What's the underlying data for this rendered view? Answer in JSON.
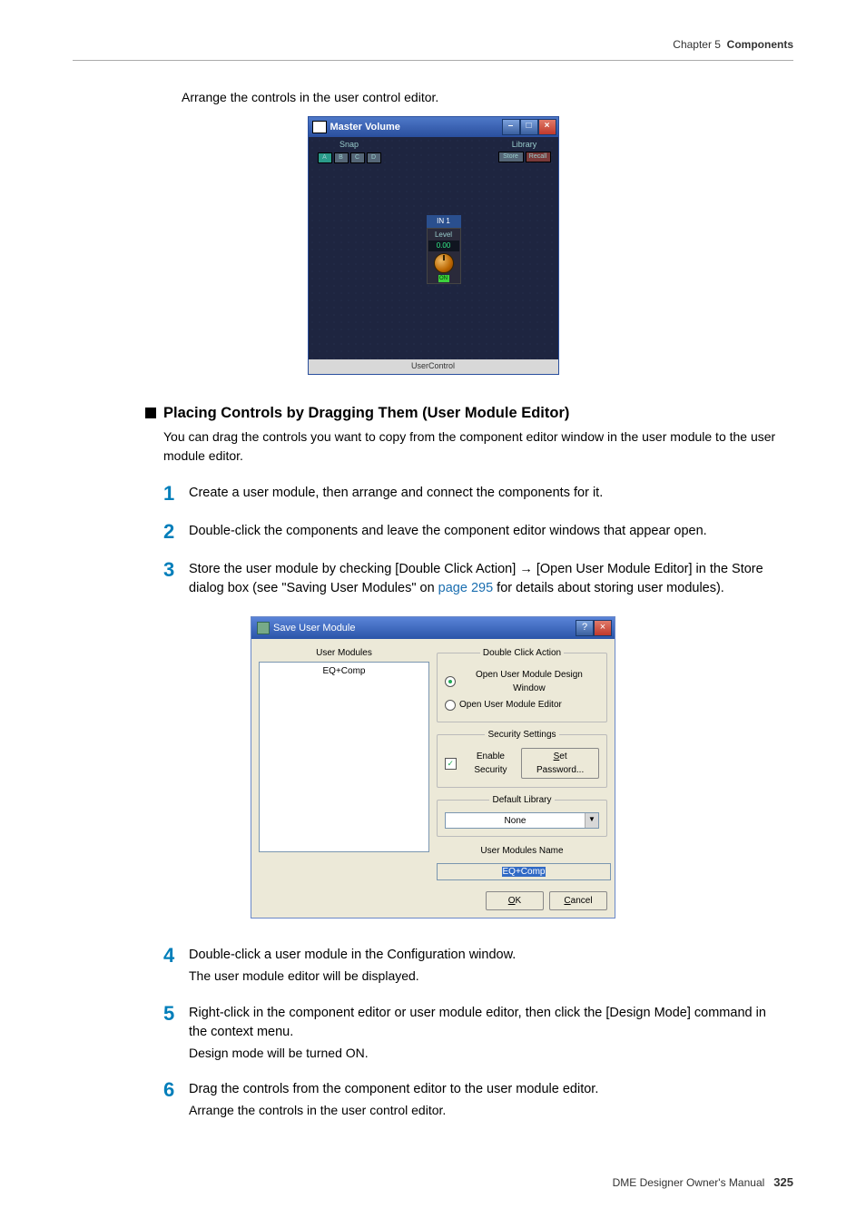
{
  "header": {
    "chapter": "Chapter 5",
    "title": "Components"
  },
  "intro": "Arrange the controls in the user control editor.",
  "mv": {
    "title": "Master Volume",
    "min": "–",
    "max": "□",
    "close": "×",
    "snap_label": "Snap",
    "snap_a": "A",
    "snap_b": "B",
    "snap_c": "C",
    "snap_d": "D",
    "lib_label": "Library",
    "lib_store": "Store",
    "lib_recall": "Recall",
    "comp_title": "IN 1",
    "level": "Level",
    "level_val": "0.00",
    "on": "ON",
    "status": "UserControl"
  },
  "section": {
    "title": "Placing Controls by Dragging Them (User Module Editor)",
    "desc": "You can drag the controls you want to copy from the component editor window in the user module to the user module editor."
  },
  "steps": {
    "s1": "Create a user module, then arrange and connect the components for it.",
    "s2": "Double-click the components and leave the component editor windows that appear open.",
    "s3a": "Store the user module by checking [Double Click Action] ",
    "arrow": "→",
    "s3b": " [Open User Module Editor] in the Store dialog box (see \"Saving User Modules\" on ",
    "s3link": "page 295",
    "s3c": " for details about storing user modules).",
    "s4a": "Double-click a user module in the Configuration window.",
    "s4b": "The user module editor will be displayed.",
    "s5a": "Right-click in the component editor or user module editor, then click the [Design Mode] command in the context menu.",
    "s5b": "Design mode will be turned ON.",
    "s6a": "Drag the controls from the component editor to the user module editor.",
    "s6b": "Arrange the controls in the user control editor."
  },
  "sum": {
    "title": "Save User Module",
    "help": "?",
    "close": "×",
    "user_modules": "User Modules",
    "list_item": "EQ+Comp",
    "dca_legend": "Double Click Action",
    "dca_open_design": "Open User Module Design Window",
    "dca_open_editor": "Open User Module Editor",
    "sec_legend": "Security Settings",
    "sec_enable": "Enable Security",
    "sec_setpw_u": "S",
    "sec_setpw": "et Password...",
    "deflib_legend": "Default Library",
    "deflib_val": "None",
    "name_label": "User Modules Name",
    "name_val": "EQ+Comp",
    "ok_u": "O",
    "ok": "K",
    "cancel_u": "C",
    "cancel": "ancel",
    "check": "✓",
    "caret": "▼"
  },
  "footer": {
    "prod": "DME Designer Owner's Manual",
    "page": "325"
  }
}
